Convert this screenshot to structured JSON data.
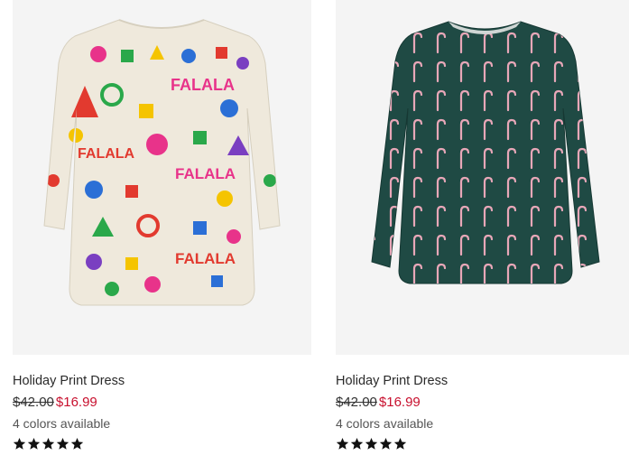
{
  "products": [
    {
      "image_alt": "Holiday Print Dress with FALALA print",
      "title": "Holiday Print Dress",
      "original_price": "$42.00",
      "sale_price": "$16.99",
      "colors_text": "4 colors available",
      "rating": 5,
      "dress_color": "#efe9dc",
      "print": "falala"
    },
    {
      "image_alt": "Holiday Print Dress with candy cane print",
      "title": "Holiday Print Dress",
      "original_price": "$42.00",
      "sale_price": "$16.99",
      "colors_text": "4 colors available",
      "rating": 5,
      "dress_color": "#1f4a44",
      "print": "candy-cane"
    }
  ],
  "colors": {
    "sale": "#c8102e",
    "image_bg": "#f4f4f4",
    "star": "#111111"
  }
}
